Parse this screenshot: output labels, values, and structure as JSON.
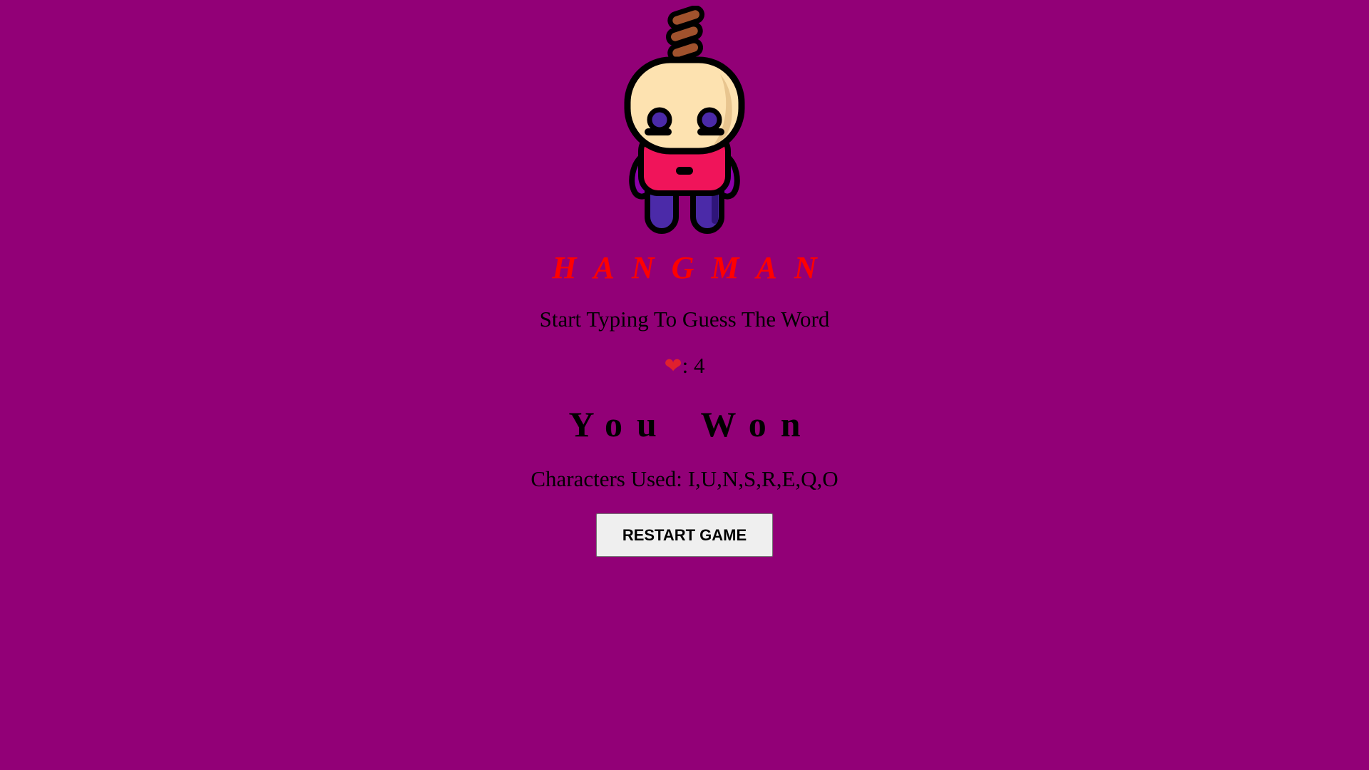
{
  "game": {
    "title": "HANGMAN",
    "instruction": "Start Typing To Guess The Word",
    "lives_icon": "heart-icon",
    "lives_separator": ": ",
    "lives_count": "4",
    "result_word_1": "You",
    "result_word_2": "Won",
    "used_label": "Characters Used: ",
    "used_chars": "I,U,N,S,R,E,Q,O",
    "restart_label": "RESTART GAME"
  },
  "colors": {
    "background": "#920077",
    "title": "#ff0000",
    "heart": "#e0202e",
    "button_bg": "#efefef"
  }
}
